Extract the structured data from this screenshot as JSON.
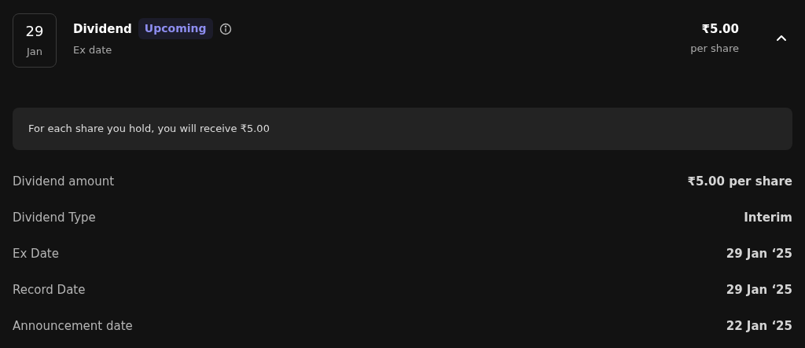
{
  "event": {
    "day": "29",
    "month": "Jan",
    "title": "Dividend",
    "badge": "Upcoming",
    "subtitle": "Ex date",
    "amount": "₹5.00",
    "amount_unit": "per share",
    "expanded": true
  },
  "note": "For each share you hold, you will receive ₹5.00",
  "details": [
    {
      "label": "Dividend amount",
      "value": "₹5.00 per share"
    },
    {
      "label": "Dividend Type",
      "value": "Interim"
    },
    {
      "label": "Ex Date",
      "value": "29 Jan ‘25"
    },
    {
      "label": "Record Date",
      "value": "29 Jan ‘25"
    },
    {
      "label": "Announcement date",
      "value": "22 Jan ‘25"
    }
  ]
}
